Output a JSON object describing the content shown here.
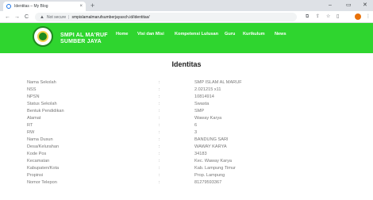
{
  "browser": {
    "tab_title": "Identitas – My Blog",
    "tab_close": "×",
    "new_tab": "+",
    "minimize": "–",
    "maximize": "▭",
    "close": "✕",
    "back": "←",
    "forward": "→",
    "reload": "C",
    "not_secure": "Not secure",
    "separator": "|",
    "url": "smpislamalmarufsumberjayasch.id/identitas/"
  },
  "site": {
    "name_line1": "SMPI AL MA'RUF",
    "name_line2": "SUMBER JAYA",
    "menu": [
      "Home",
      "Visi dan Misi",
      "Kompetensi Lulusan",
      "Guru",
      "Kurikulum",
      "News"
    ],
    "colors": {
      "header": "#2fd52f",
      "text": "#ffffff"
    }
  },
  "page": {
    "title": "Identitas",
    "rows": [
      {
        "label": "Nama Sekolah",
        "value": "SMP ISLAM AL MARUF"
      },
      {
        "label": "NSS",
        "value": "2.021215 x11"
      },
      {
        "label": "NPSN",
        "value": "10814914"
      },
      {
        "label": "Status Sekolah",
        "value": "Swasta"
      },
      {
        "label": "Bentuk Pendidikan",
        "value": "SMP"
      },
      {
        "label": "Alamat",
        "value": "Waway Karya"
      },
      {
        "label": "RT",
        "value": "6"
      },
      {
        "label": "RW",
        "value": "3"
      },
      {
        "label": "Nama Dusun",
        "value": "BANDUNG SARI"
      },
      {
        "label": "Desa/Kelurahan",
        "value": "WAWAY KARYA"
      },
      {
        "label": "Kode Pos",
        "value": "34183"
      },
      {
        "label": "Kecamatan",
        "value": "Kec. Waway Karya"
      },
      {
        "label": "Kabupaten/Kota",
        "value": "Kab. Lampung Timur"
      },
      {
        "label": "Propinsi",
        "value": "Prop. Lampung"
      },
      {
        "label": "Nomor Telepon",
        "value": "81279593367"
      }
    ]
  }
}
